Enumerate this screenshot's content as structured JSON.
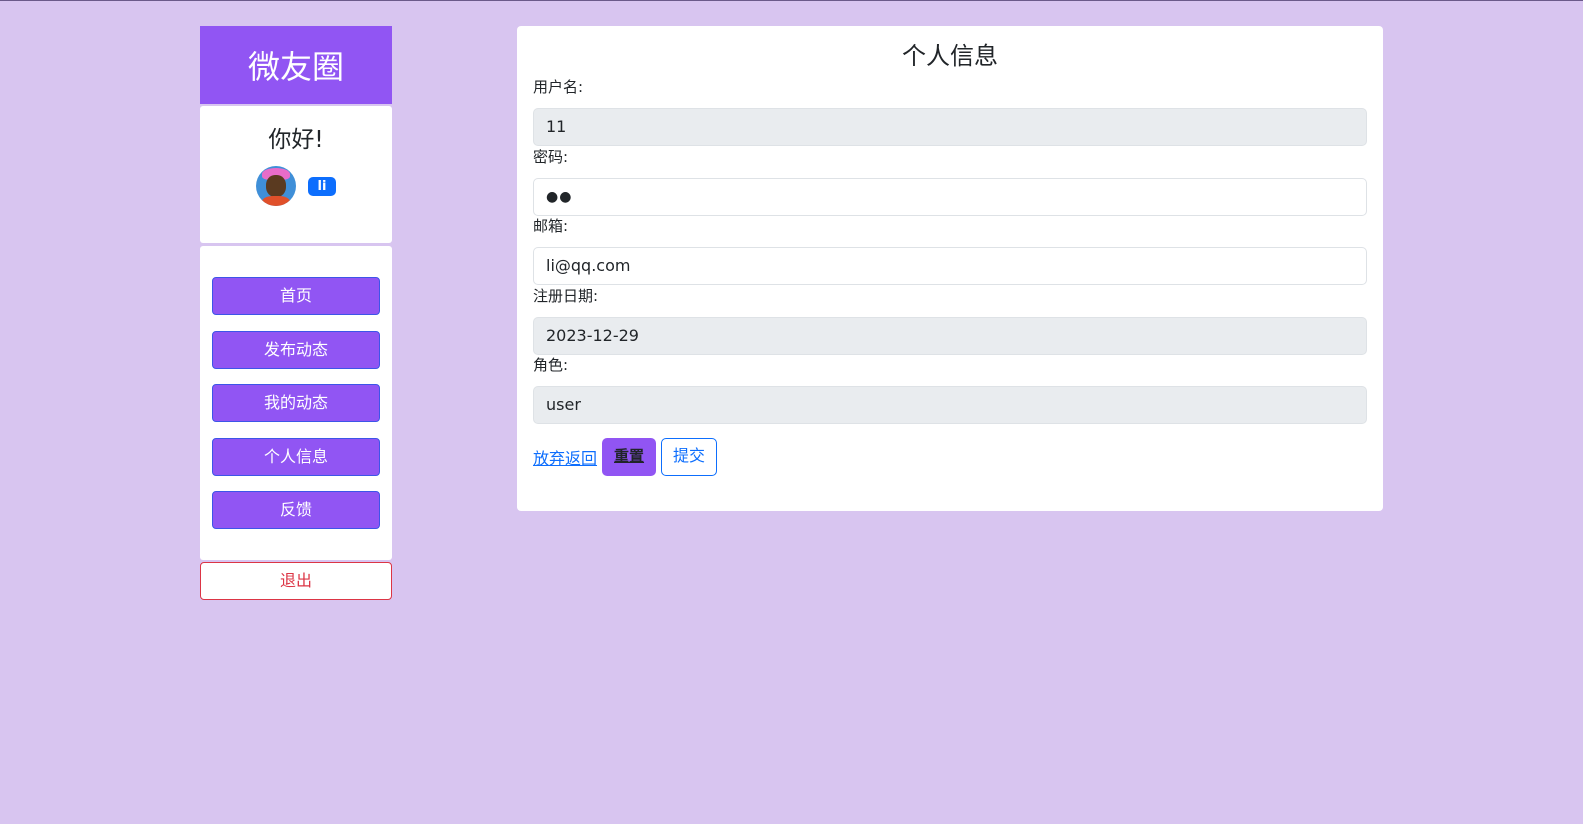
{
  "sidebar": {
    "brand": "微友圈",
    "greeting": "你好!",
    "username_badge": "li",
    "nav": [
      "首页",
      "发布动态",
      "我的动态",
      "个人信息",
      "反馈"
    ],
    "logout": "退出"
  },
  "profile": {
    "title": "个人信息",
    "username_label": "用户名:",
    "username_value": "11",
    "password_label": "密码:",
    "password_value": "●●",
    "email_label": "邮箱:",
    "email_value": "li@qq.com",
    "regdate_label": "注册日期:",
    "regdate_value": "2023-12-29",
    "role_label": "角色:",
    "role_value": "user"
  },
  "actions": {
    "back": "放弃返回",
    "reset": "重置",
    "submit": "提交"
  },
  "colors": {
    "background": "#d8c5f0",
    "accent": "#9155f3",
    "primary": "#0d6efd",
    "danger": "#dc3545"
  }
}
